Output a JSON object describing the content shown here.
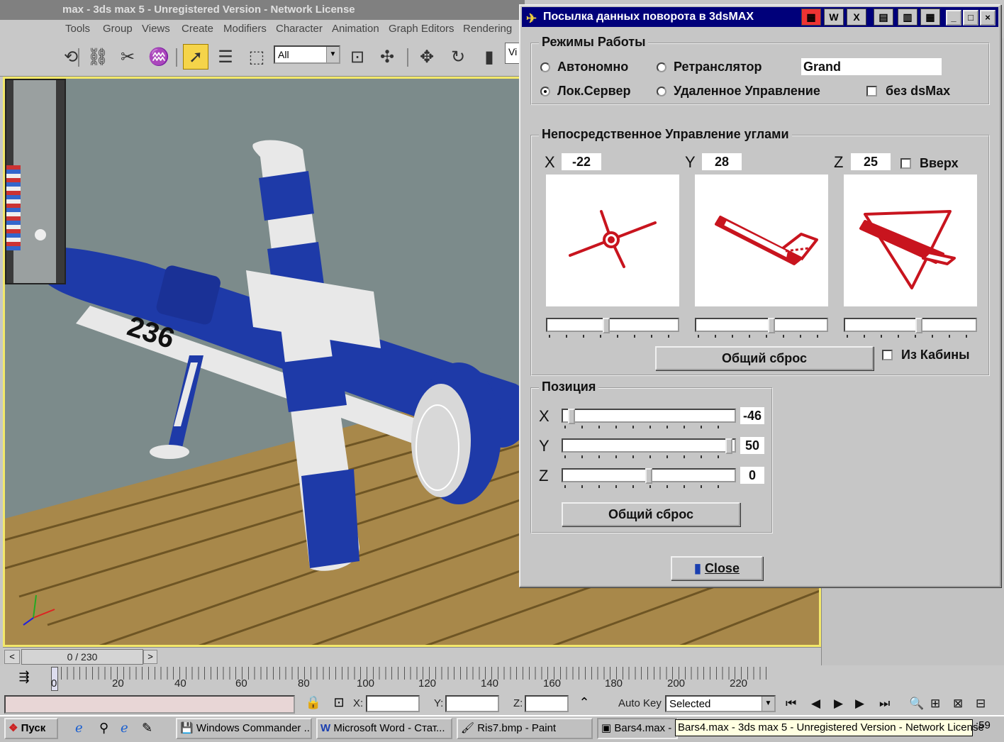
{
  "max": {
    "title": "max - 3ds max 5 - Unregistered Version - Network License",
    "menu": [
      "Tools",
      "Group",
      "Views",
      "Create",
      "Modifiers",
      "Character",
      "Animation",
      "Graph Editors",
      "Rendering"
    ],
    "selection_filter": "All",
    "viewport_label_partial": "Vi",
    "time_slider": "0 / 230",
    "track_labels": [
      "0",
      "20",
      "40",
      "60",
      "80",
      "100",
      "120",
      "140",
      "160",
      "180",
      "200",
      "220"
    ],
    "coord_x_label": "X:",
    "coord_y_label": "Y:",
    "coord_z_label": "Z:",
    "auto_key_label": "Auto Key",
    "selected_dropdown": "Selected",
    "colors": {
      "viewport_border": "#f3e86a",
      "plane_blue": "#1e3aa8",
      "plane_white": "#e8e8e8",
      "floor": "#a8884a"
    }
  },
  "taskbar": {
    "start": "Пуск",
    "buttons": [
      "Windows Commander ...",
      "Microsoft Word - Стат...",
      "Ris7.bmp - Paint",
      "Bars4.max -"
    ],
    "clock_partial": ":59",
    "tooltip": "Bars4.max - 3ds max 5 - Unregistered Version - Network License"
  },
  "dialog": {
    "title": "Посылка данных поворота  в 3dsMAX",
    "modes": {
      "group_title": "Режимы Работы",
      "autonomous": "Автономно",
      "relay": "Ретранслятор",
      "relay_host": "Grand",
      "local_server": "Лок.Сервер",
      "remote_control": "Удаленное Управление",
      "no_dsmax": "без dsMax",
      "selected": "local_server"
    },
    "angles": {
      "group_title": "Непосредственное Управление  углами",
      "x_label": "X",
      "x_value": "-22",
      "y_label": "Y",
      "y_value": "28",
      "z_label": "Z",
      "z_value": "25",
      "up_label": "Вверх",
      "slider_fractions": [
        0.45,
        0.58,
        0.57
      ],
      "reset": "Общий сброс",
      "from_cockpit": "Из Кабины"
    },
    "position": {
      "group_title": "Позиция",
      "x_label": "X",
      "x_value": "-46",
      "y_label": "Y",
      "y_value": "50",
      "z_label": "Z",
      "z_value": "0",
      "slider_fractions": [
        0.04,
        0.98,
        0.5
      ],
      "reset": "Общий сброс"
    },
    "close": "Close"
  }
}
